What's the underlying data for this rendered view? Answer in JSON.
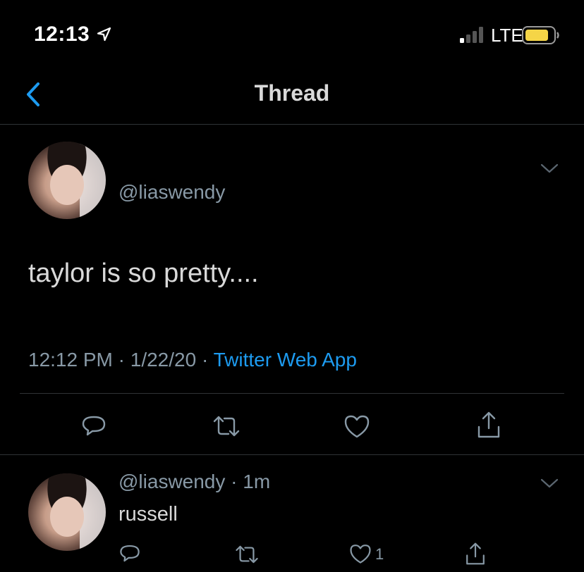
{
  "status_bar": {
    "time": "12:13",
    "network": "LTE",
    "location_icon": "location-arrow-icon",
    "signal_icon": "signal-bars-icon",
    "battery_icon": "battery-icon",
    "battery_color": "#f5d547"
  },
  "nav": {
    "title": "Thread",
    "back_icon": "chevron-left-icon",
    "accent": "#1d9bf0"
  },
  "tweet": {
    "handle": "@liaswendy",
    "text": "taylor is so pretty....",
    "time": "12:12 PM",
    "date": "1/22/20",
    "separator": "·",
    "source": "Twitter Web App",
    "actions": [
      "reply-icon",
      "retweet-icon",
      "like-icon",
      "share-icon"
    ]
  },
  "reply": {
    "handle": "@liaswendy",
    "separator": "·",
    "age": "1m",
    "text": "russell",
    "like_count": "1"
  }
}
